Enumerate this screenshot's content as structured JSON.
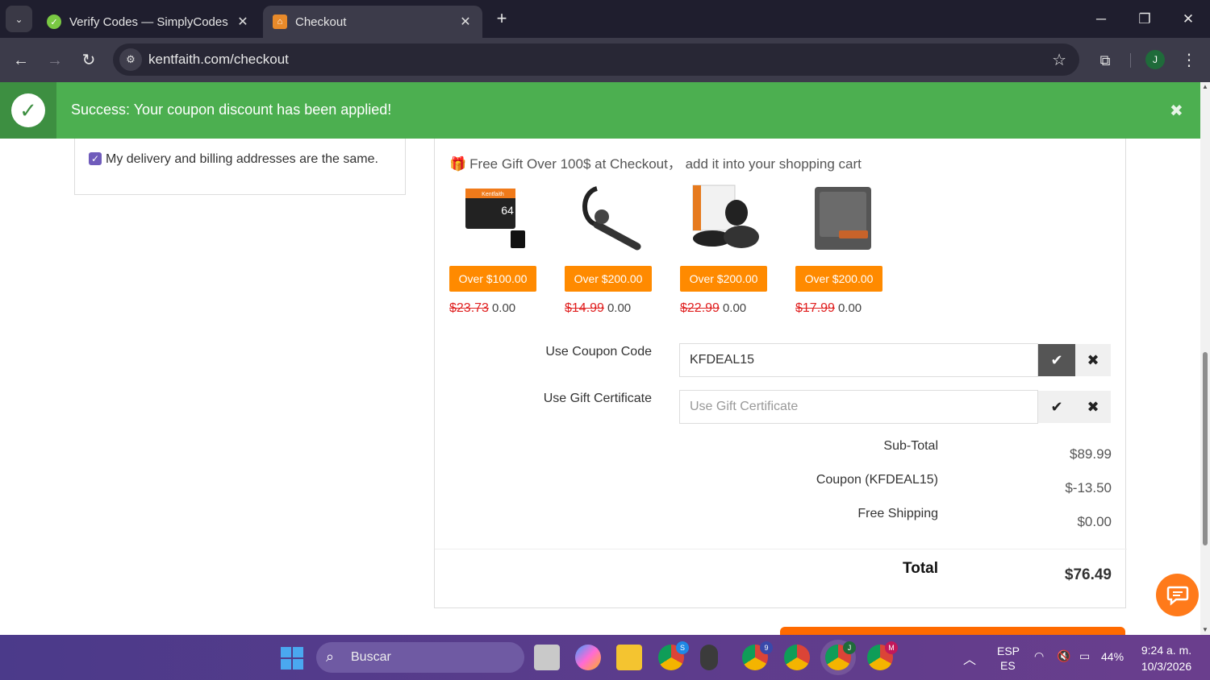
{
  "browser": {
    "tabs": [
      {
        "title": "Verify Codes — SimplyCodes",
        "active": false
      },
      {
        "title": "Checkout",
        "active": true
      }
    ],
    "url": "kentfaith.com/checkout"
  },
  "alert": {
    "message": "Success: Your coupon discount has been applied!"
  },
  "address": {
    "same_label": "My delivery and billing addresses are the same.",
    "checked": true
  },
  "gifts": {
    "heading": "Free Gift Over 100$ at Checkout， add it into your shopping cart",
    "items": [
      {
        "badge": "Over $100.00",
        "old_price": "$23.73",
        "price": "0.00"
      },
      {
        "badge": "Over $200.00",
        "old_price": "$14.99",
        "price": "0.00"
      },
      {
        "badge": "Over $200.00",
        "old_price": "$22.99",
        "price": "0.00"
      },
      {
        "badge": "Over $200.00",
        "old_price": "$17.99",
        "price": "0.00"
      }
    ]
  },
  "coupon": {
    "label": "Use Coupon Code",
    "value": "KFDEAL15"
  },
  "gift_certificate": {
    "label": "Use Gift Certificate",
    "placeholder": "Use Gift Certificate"
  },
  "summary": {
    "rows": [
      {
        "label": "Sub-Total",
        "value": "$89.99"
      },
      {
        "label": "Coupon (KFDEAL15)",
        "value": "$-13.50"
      },
      {
        "label": "Free Shipping",
        "value": "$0.00"
      }
    ],
    "total_label": "Total",
    "total_value": "$76.49"
  },
  "taskbar": {
    "search": "Buscar",
    "lang": "ESP",
    "lang_sub": "ES",
    "battery": "44%",
    "time": "9:24 a. m.",
    "date": "10/3/2026",
    "badges": [
      "S",
      "9",
      "J",
      "M"
    ]
  },
  "colors": {
    "alert_green": "#4caf50",
    "accent_orange": "#ff8a00",
    "old_price_red": "#e02020"
  }
}
